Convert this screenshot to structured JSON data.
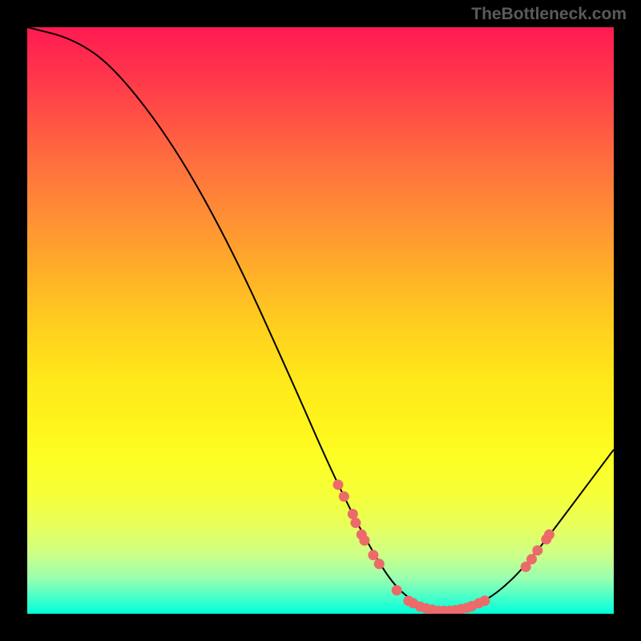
{
  "watermark": "TheBottleneck.com",
  "chart_data": {
    "type": "line",
    "title": "",
    "xlabel": "",
    "ylabel": "",
    "xlim": [
      0,
      100
    ],
    "ylim": [
      0,
      100
    ],
    "grid": false,
    "curve": [
      {
        "x": 0,
        "y": 100
      },
      {
        "x": 8,
        "y": 98
      },
      {
        "x": 15,
        "y": 93
      },
      {
        "x": 25,
        "y": 80
      },
      {
        "x": 35,
        "y": 62
      },
      {
        "x": 45,
        "y": 40
      },
      {
        "x": 52,
        "y": 24
      },
      {
        "x": 58,
        "y": 12
      },
      {
        "x": 63,
        "y": 4
      },
      {
        "x": 68,
        "y": 1
      },
      {
        "x": 73,
        "y": 0.5
      },
      {
        "x": 78,
        "y": 2
      },
      {
        "x": 83,
        "y": 6
      },
      {
        "x": 88,
        "y": 12
      },
      {
        "x": 94,
        "y": 20
      },
      {
        "x": 100,
        "y": 28
      }
    ],
    "points_on_curve": [
      {
        "x": 53,
        "y": 22
      },
      {
        "x": 54,
        "y": 20
      },
      {
        "x": 55.5,
        "y": 17
      },
      {
        "x": 56,
        "y": 15.5
      },
      {
        "x": 57,
        "y": 13.5
      },
      {
        "x": 57.5,
        "y": 12.5
      },
      {
        "x": 59,
        "y": 10
      },
      {
        "x": 60,
        "y": 8.5
      },
      {
        "x": 63,
        "y": 4
      },
      {
        "x": 65,
        "y": 2.2
      },
      {
        "x": 65.8,
        "y": 1.8
      },
      {
        "x": 67,
        "y": 1.2
      },
      {
        "x": 68,
        "y": 0.9
      },
      {
        "x": 69,
        "y": 0.7
      },
      {
        "x": 70,
        "y": 0.5
      },
      {
        "x": 71,
        "y": 0.5
      },
      {
        "x": 72,
        "y": 0.5
      },
      {
        "x": 73,
        "y": 0.6
      },
      {
        "x": 74,
        "y": 0.8
      },
      {
        "x": 75,
        "y": 1.0
      },
      {
        "x": 75.8,
        "y": 1.3
      },
      {
        "x": 77,
        "y": 1.8
      },
      {
        "x": 78,
        "y": 2.2
      },
      {
        "x": 85,
        "y": 8
      },
      {
        "x": 86,
        "y": 9.3
      },
      {
        "x": 87,
        "y": 10.8
      },
      {
        "x": 88.5,
        "y": 12.7
      },
      {
        "x": 89,
        "y": 13.5
      }
    ],
    "point_color": "#ec6a6a",
    "curve_color": "#000000",
    "gradient_stops": [
      {
        "pos": 0,
        "color": "#ff1a52"
      },
      {
        "pos": 50,
        "color": "#ffd21e"
      },
      {
        "pos": 100,
        "color": "#00ffdb"
      }
    ]
  }
}
